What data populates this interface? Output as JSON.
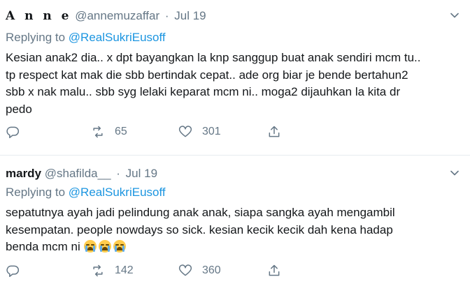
{
  "tweets": [
    {
      "author": "A n n e",
      "handle": "@annemuzaffar",
      "separator": "·",
      "time": "Jul 19",
      "replying_prefix": "Replying to",
      "replying_mention": "@RealSukriEusoff",
      "text": "Kesian anak2 dia.. x dpt bayangkan la knp sanggup buat anak sendiri mcm tu..\ntp respect kat mak die sbb bertindak cepat.. ade org biar je bende bertahun2\nsbb x nak malu.. sbb syg lelaki keparat mcm ni.. moga2 dijauhkan la kita dr\npedo",
      "retweets": "65",
      "likes": "301"
    },
    {
      "author": "mardy",
      "handle": "@shafilda__",
      "separator": "·",
      "time": "Jul 19",
      "replying_prefix": "Replying to",
      "replying_mention": "@RealSukriEusoff",
      "text": "sepatutnya ayah jadi pelindung anak anak, siapa sangka ayah mengambil\nkesempatan. people nowdays so sick. kesian kecik kecik dah kena hadap\nbenda mcm ni ",
      "emoji": "loudly-crying-face-icon",
      "emoji_count": 3,
      "retweets": "142",
      "likes": "360"
    }
  ],
  "colors": {
    "text": "#14171a",
    "muted": "#657786",
    "link": "#1b95e0",
    "divider": "#e6ecf0"
  }
}
